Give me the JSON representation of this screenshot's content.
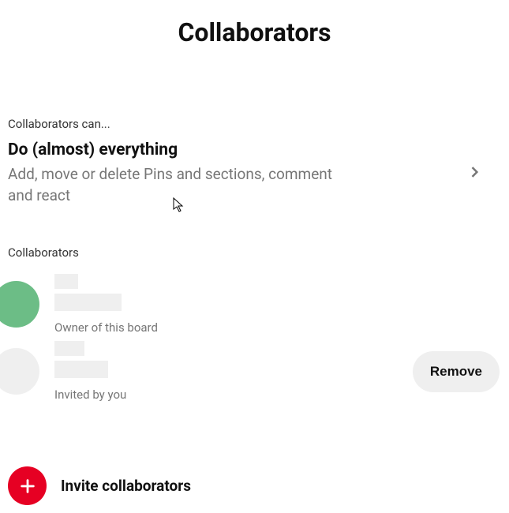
{
  "title": "Collaborators",
  "permissions": {
    "section_label": "Collaborators can...",
    "title": "Do (almost) everything",
    "description": "Add, move or delete Pins and sections, comment and react"
  },
  "list": {
    "section_label": "Collaborators",
    "items": [
      {
        "subtext": "Owner of this board"
      },
      {
        "subtext": "Invited by you"
      }
    ],
    "remove_label": "Remove"
  },
  "invite": {
    "label": "Invite collaborators"
  }
}
